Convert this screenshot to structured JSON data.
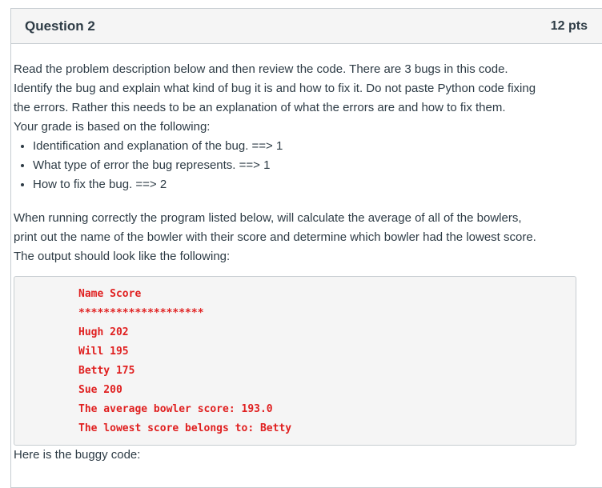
{
  "question": {
    "title": "Question 2",
    "points": "12 pts"
  },
  "body": {
    "intro_line_1": "Read the problem description below and then review the code.  There are 3 bugs in this code.",
    "intro_line_2": "Identify the bug and explain what kind of bug it is and how to fix it.  Do not paste Python code fixing",
    "intro_line_3": "the errors.  Rather this needs to be an explanation of what the errors are and how to fix them.",
    "grade_line": "Your grade is based on the following:",
    "criteria": [
      "Identification and explanation of the bug. ==> 1",
      "What type of error the bug represents. ==> 1",
      "How to fix the bug. ==> 2"
    ],
    "desc_line_1": "When running correctly the program listed below, will calculate the average of all of the bowlers,",
    "desc_line_2": "print out the name of the bowler with their score and determine which bowler had the lowest score.",
    "desc_line_3": "The output should look like the following:",
    "footer": "Here is the buggy code:"
  },
  "output_sample": {
    "lines": [
      "Name Score",
      "********************",
      "Hugh 202",
      "Will 195",
      "Betty 175",
      "Sue 200",
      "The average bowler score: 193.0",
      "The lowest score belongs to: Betty"
    ]
  },
  "colors": {
    "header_bg": "#f5f5f5",
    "border": "#c7cdd1",
    "text": "#2d3b45",
    "code_text": "#e02020",
    "code_bg": "#f5f5f5"
  }
}
